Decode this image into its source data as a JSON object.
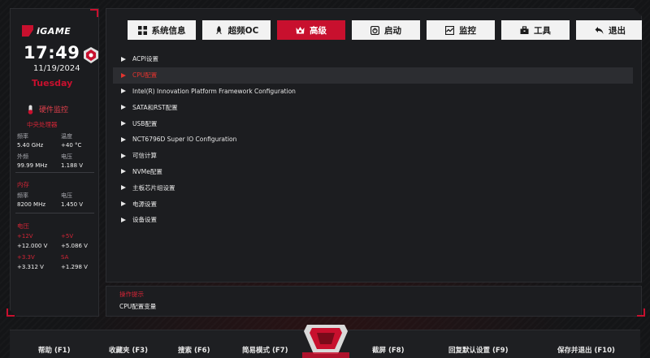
{
  "brand": {
    "logo_text": "iGAME"
  },
  "clock": {
    "time": "17:49",
    "date": "11/19/2024",
    "weekday": "Tuesday"
  },
  "hw_monitor": {
    "title": "硬件监控",
    "cpu": {
      "section": "中央处理器",
      "freq_label": "频率",
      "freq_value": "5.40 GHz",
      "temp_label": "温度",
      "temp_value": "+40 °C",
      "bclk_label": "外频",
      "bclk_value": "99.99 MHz",
      "volt_label": "电压",
      "volt_value": "1.188 V"
    },
    "memory": {
      "section": "内存",
      "freq_label": "频率",
      "freq_value": "8200 MHz",
      "volt_label": "电压",
      "volt_value": "1.450 V"
    },
    "voltage": {
      "section": "电压",
      "v12_label": "+12V",
      "v12_value": "+12.000 V",
      "v5_label": "+5V",
      "v5_value": "+5.086 V",
      "v33_label": "+3.3V",
      "v33_value": "+3.312 V",
      "sa_label": "SA",
      "sa_value": "+1.298 V"
    }
  },
  "tabs": [
    {
      "label": "系统信息",
      "icon": "grid-icon"
    },
    {
      "label": "超频OC",
      "icon": "rocket-icon"
    },
    {
      "label": "高级",
      "icon": "crown-icon"
    },
    {
      "label": "启动",
      "icon": "power-icon"
    },
    {
      "label": "监控",
      "icon": "chart-icon"
    },
    {
      "label": "工具",
      "icon": "toolbox-icon"
    },
    {
      "label": "退出",
      "icon": "return-icon"
    }
  ],
  "active_tab": "高级",
  "menu": [
    "ACPI设置",
    "CPU配置",
    "Intel(R) Innovation Platform Framework Configuration",
    "SATA和RST配置",
    "USB配置",
    "NCT6796D Super IO Configuration",
    "可信计算",
    "NVMe配置",
    "主板芯片组设置",
    "电源设置",
    "设备设置"
  ],
  "selected_menu": "CPU配置",
  "help": {
    "title": "操作提示",
    "text": "CPU配置变量"
  },
  "footer": {
    "help": "帮助 (F1)",
    "favorites": "收藏夹 (F3)",
    "search": "搜索 (F6)",
    "easy_mode": "简易模式 (F7)",
    "screenshot": "截屏 (F8)",
    "defaults": "回复默认设置 (F9)",
    "save_exit": "保存并退出 (F10)"
  },
  "colors": {
    "accent": "#c8102e",
    "panel": "#1c1d20",
    "background": "#141517"
  }
}
